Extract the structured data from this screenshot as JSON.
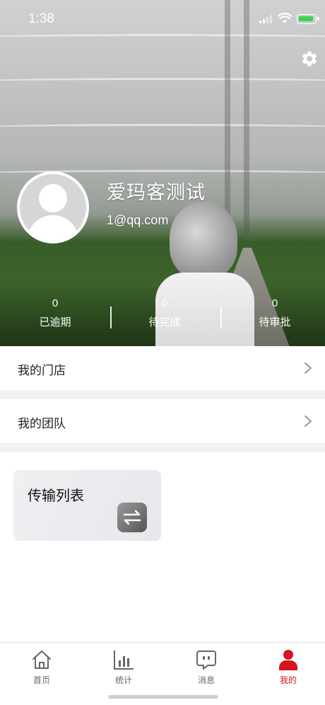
{
  "status_bar": {
    "time": "1:38"
  },
  "profile": {
    "name": "爱玛客测试",
    "email": "1@qq.com"
  },
  "stats": [
    {
      "value": "0",
      "label": "已逾期"
    },
    {
      "value": "0",
      "label": "待完成"
    },
    {
      "value": "0",
      "label": "待审批"
    }
  ],
  "menu": {
    "my_store": "我的门店",
    "my_team": "我的团队"
  },
  "transfer_card": {
    "title": "传输列表"
  },
  "tabs": [
    {
      "label": "首页",
      "icon": "home-icon"
    },
    {
      "label": "统计",
      "icon": "bar-chart-icon"
    },
    {
      "label": "消息",
      "icon": "message-icon"
    },
    {
      "label": "我的",
      "icon": "user-icon"
    }
  ],
  "colors": {
    "accent": "#d5141f",
    "tab_inactive": "#666666"
  }
}
